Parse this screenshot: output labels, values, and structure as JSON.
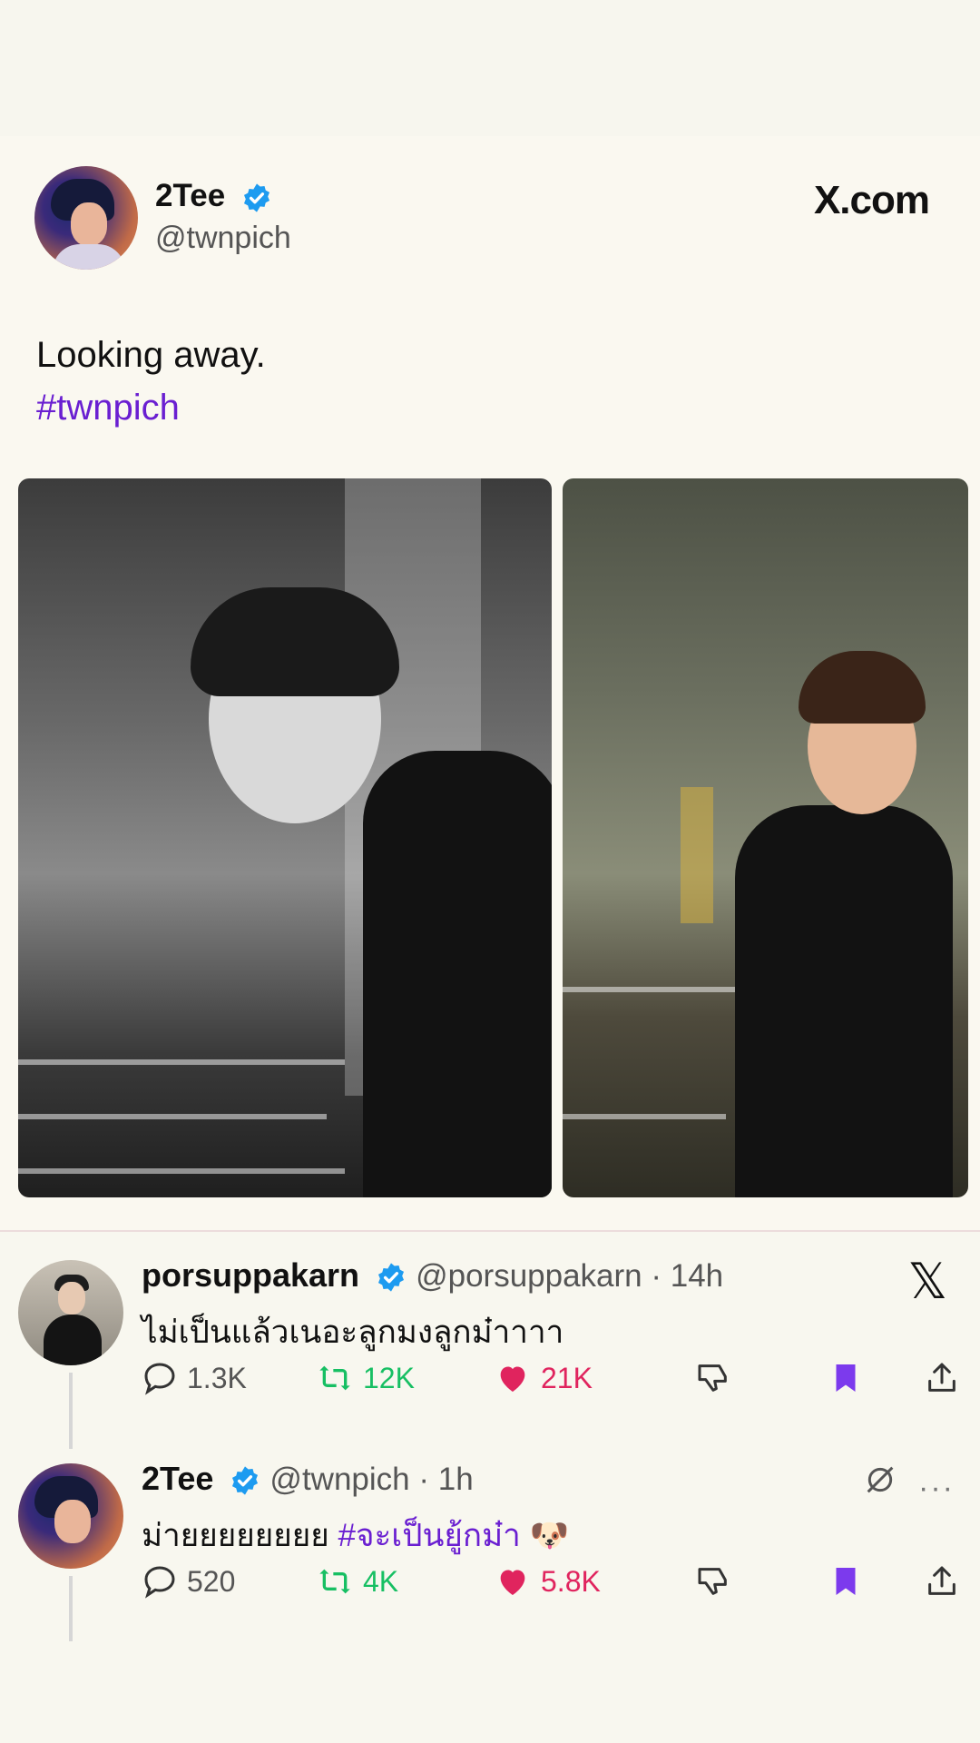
{
  "tweet": {
    "author_name": "2Tee",
    "handle": "@twnpich",
    "site": "X.com",
    "text": "Looking away.",
    "hashtag": "#twnpich"
  },
  "replies": [
    {
      "name": "porsuppakarn",
      "handle": "@porsuppakarn · 14h",
      "text": "ไม่เป็นแล้วเนอะลูกมงลูกม๋าาาา",
      "comments": "1.3K",
      "retweets": "12K",
      "likes": "21K"
    },
    {
      "name": "2Tee",
      "handle": "@twnpich · 1h",
      "text_plain": "ม่ายยยยยยยย ",
      "text_hashtag": "#จะเป็นยู้กม๋า",
      "emoji": "🐶",
      "comments": "520",
      "retweets": "4K",
      "likes": "5.8K",
      "more": "···"
    }
  ],
  "icons": {
    "verified": "verified-badge-icon",
    "x_logo": "x-logo-icon",
    "comment": "comment-icon",
    "retweet": "retweet-icon",
    "like": "heart-icon",
    "dislike": "thumbs-down-icon",
    "bookmark": "bookmark-icon",
    "share": "share-icon"
  },
  "colors": {
    "hashtag": "#6a1fd1",
    "retweet": "#17bf63",
    "like": "#e0245e",
    "bookmark": "#7c3aed",
    "verified": "#1d9bf0"
  }
}
